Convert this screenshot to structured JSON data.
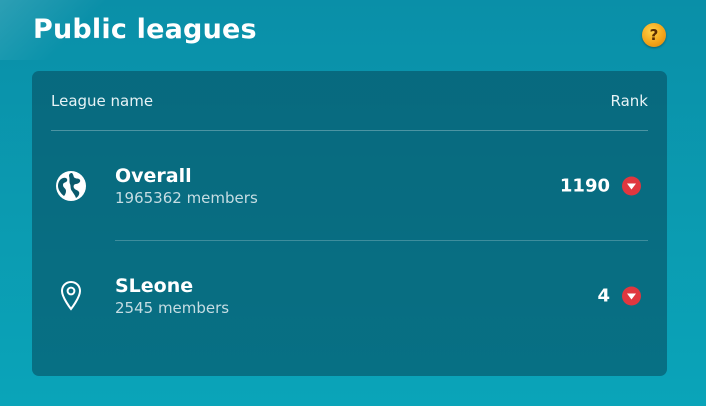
{
  "page": {
    "title": "Public leagues"
  },
  "help": {
    "icon": "help-icon",
    "glyph": "?",
    "color": "#f3a51a"
  },
  "table": {
    "col_league": "League name",
    "col_rank": "Rank"
  },
  "leagues": [
    {
      "name": "Overall",
      "members": "1965362 members",
      "rank": "1190",
      "icon": "globe-icon",
      "trend": "down"
    },
    {
      "name": "SLeone",
      "members": "2545 members",
      "rank": "4",
      "icon": "location-pin-icon",
      "trend": "down"
    }
  ],
  "colors": {
    "accent": "#0b9bb1",
    "panel": "#0a5a6c",
    "trend_down": "#e0373f"
  }
}
